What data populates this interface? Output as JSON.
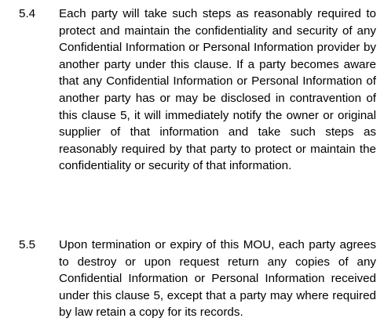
{
  "document": {
    "clauses": [
      {
        "number": "5.4",
        "text": "Each party will take such steps as reasonably required to protect and maintain the confidentiality and security of any Confidential Information or Personal Information provider by another party under this clause. If a party becomes aware that any Confidential Information or Personal Information of another party has or may be disclosed in contravention of this clause 5, it will immediately notify the owner or original supplier of that information and take such steps as reasonably required by that party to protect or maintain the confidentiality or security of that information."
      },
      {
        "number": "5.5",
        "text": "Upon termination or expiry of this MOU, each party agrees to destroy or upon request return any copies of any Confidential Information or Personal Information received under this clause 5, except that a party may where required by law retain a copy for its records."
      }
    ]
  }
}
